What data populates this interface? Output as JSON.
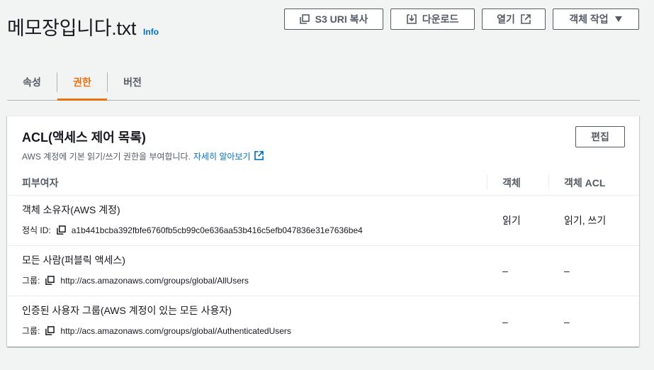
{
  "header": {
    "title": "메모장입니다.txt",
    "info": "Info"
  },
  "actions": {
    "copy_s3_uri": "S3 URI 복사",
    "download": "다운로드",
    "open": "열기",
    "object_actions": "객체 작업"
  },
  "tabs": [
    {
      "label": "속성",
      "selected": false
    },
    {
      "label": "권한",
      "selected": true
    },
    {
      "label": "버전",
      "selected": false
    }
  ],
  "acl": {
    "title": "ACL(액세스 제어 목록)",
    "description": "AWS 계정에 기본 읽기/쓰기 권한을 부여합니다.",
    "learn_more": "자세히 알아보기",
    "edit": "편집",
    "columns": {
      "grantee": "피부여자",
      "object": "객체",
      "object_acl": "객체 ACL"
    },
    "rows": [
      {
        "grantee": "객체 소유자(AWS 계정)",
        "meta_label": "정식 ID:",
        "meta_value": "a1b441bcba392fbfe6760fb5cb99c0e636aa53b416c5efb047836e31e7636be4",
        "object": "읽기",
        "object_acl": "읽기, 쓰기"
      },
      {
        "grantee": "모든 사람(퍼블릭 액세스)",
        "meta_label": "그룹:",
        "meta_value": "http://acs.amazonaws.com/groups/global/AllUsers",
        "object": "–",
        "object_acl": "–"
      },
      {
        "grantee": "인증된 사용자 그룹(AWS 계정이 있는 모든 사용자)",
        "meta_label": "그룹:",
        "meta_value": "http://acs.amazonaws.com/groups/global/AuthenticatedUsers",
        "object": "–",
        "object_acl": "–"
      }
    ]
  },
  "colors": {
    "accent": "#ec7211",
    "link": "#0073bb",
    "text": "#16191f",
    "secondary_text": "#545b64"
  }
}
